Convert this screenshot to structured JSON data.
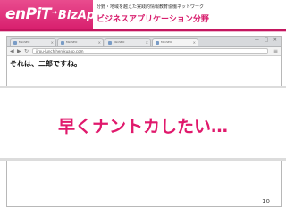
{
  "header": {
    "logo_main": "enPiT",
    "logo_arrow": "→",
    "logo_sub": "BizApp",
    "tagline": "分野・地域を越えた実践的情報教育協働ネットワーク",
    "project_title": "ビジネスアプリケーション分野",
    "brand_color": "#d81f6e"
  },
  "browser": {
    "tabs": [
      {
        "title": "MiniSEO"
      },
      {
        "title": "MiniSEO"
      },
      {
        "title": "MiniSEO"
      },
      {
        "title": "MiniSEO"
      }
    ],
    "window_controls": "— □ ✕",
    "back_icon": "arrow-left-icon",
    "forward_icon": "arrow-right-icon",
    "reload_icon": "reload-icon",
    "address_url": "jirou-lunch.herokuapp.com",
    "menu_icon": "menu-icon",
    "page_text": "それは、二郎ですね。"
  },
  "overlay": {
    "message": "早くナントカしたい…",
    "accent_color": "#e0196c"
  },
  "slide": {
    "page_number": "10"
  }
}
